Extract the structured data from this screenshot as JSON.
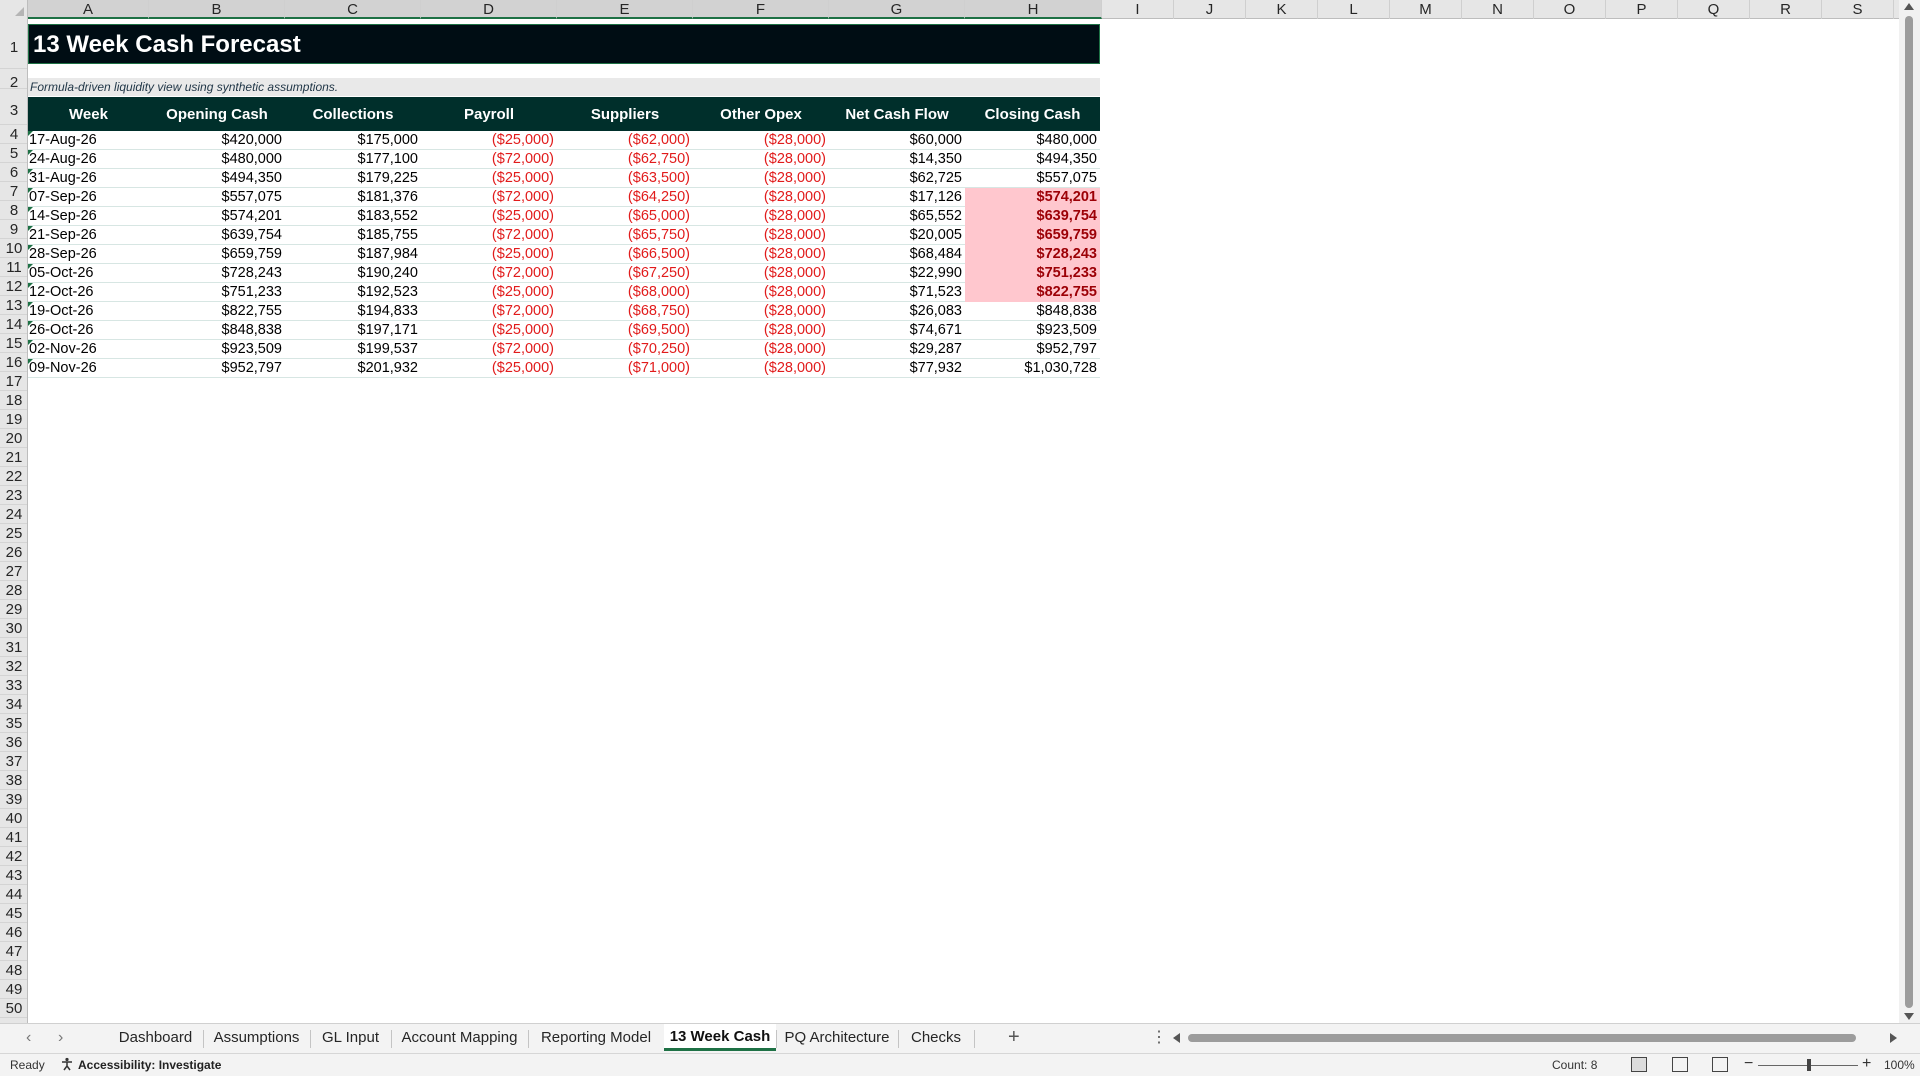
{
  "columns": [
    "A",
    "B",
    "C",
    "D",
    "E",
    "F",
    "G",
    "H",
    "I",
    "J",
    "K",
    "L",
    "M",
    "N",
    "O",
    "P",
    "Q",
    "R",
    "S"
  ],
  "rows_visible": [
    "1",
    "2",
    "3",
    "4",
    "5",
    "6",
    "7",
    "8",
    "9",
    "10",
    "11",
    "12",
    "13",
    "14",
    "15",
    "16",
    "17",
    "18",
    "19",
    "20",
    "21",
    "22",
    "23",
    "24",
    "25",
    "26",
    "27",
    "28",
    "29",
    "30",
    "31",
    "32",
    "33",
    "34",
    "35",
    "36",
    "37",
    "38",
    "39",
    "40",
    "41",
    "42",
    "43",
    "44",
    "45",
    "46",
    "47",
    "48",
    "49",
    "50"
  ],
  "sheet": {
    "title": "13 Week Cash Forecast",
    "subtitle": "Formula-driven liquidity view using synthetic assumptions.",
    "headers": [
      "Week",
      "Opening Cash",
      "Collections",
      "Payroll",
      "Suppliers",
      "Other Opex",
      "Net Cash Flow",
      "Closing Cash"
    ],
    "rows": [
      {
        "week": "17-Aug-26",
        "opening": "$420,000",
        "collections": "$175,000",
        "payroll": "($25,000)",
        "suppliers": "($62,000)",
        "other": "($28,000)",
        "net": "$60,000",
        "closing": "$480,000",
        "highlight": false
      },
      {
        "week": "24-Aug-26",
        "opening": "$480,000",
        "collections": "$177,100",
        "payroll": "($72,000)",
        "suppliers": "($62,750)",
        "other": "($28,000)",
        "net": "$14,350",
        "closing": "$494,350",
        "highlight": false
      },
      {
        "week": "31-Aug-26",
        "opening": "$494,350",
        "collections": "$179,225",
        "payroll": "($25,000)",
        "suppliers": "($63,500)",
        "other": "($28,000)",
        "net": "$62,725",
        "closing": "$557,075",
        "highlight": false
      },
      {
        "week": "07-Sep-26",
        "opening": "$557,075",
        "collections": "$181,376",
        "payroll": "($72,000)",
        "suppliers": "($64,250)",
        "other": "($28,000)",
        "net": "$17,126",
        "closing": "$574,201",
        "highlight": true
      },
      {
        "week": "14-Sep-26",
        "opening": "$574,201",
        "collections": "$183,552",
        "payroll": "($25,000)",
        "suppliers": "($65,000)",
        "other": "($28,000)",
        "net": "$65,552",
        "closing": "$639,754",
        "highlight": true
      },
      {
        "week": "21-Sep-26",
        "opening": "$639,754",
        "collections": "$185,755",
        "payroll": "($72,000)",
        "suppliers": "($65,750)",
        "other": "($28,000)",
        "net": "$20,005",
        "closing": "$659,759",
        "highlight": true
      },
      {
        "week": "28-Sep-26",
        "opening": "$659,759",
        "collections": "$187,984",
        "payroll": "($25,000)",
        "suppliers": "($66,500)",
        "other": "($28,000)",
        "net": "$68,484",
        "closing": "$728,243",
        "highlight": true
      },
      {
        "week": "05-Oct-26",
        "opening": "$728,243",
        "collections": "$190,240",
        "payroll": "($72,000)",
        "suppliers": "($67,250)",
        "other": "($28,000)",
        "net": "$22,990",
        "closing": "$751,233",
        "highlight": true
      },
      {
        "week": "12-Oct-26",
        "opening": "$751,233",
        "collections": "$192,523",
        "payroll": "($25,000)",
        "suppliers": "($68,000)",
        "other": "($28,000)",
        "net": "$71,523",
        "closing": "$822,755",
        "highlight": true
      },
      {
        "week": "19-Oct-26",
        "opening": "$822,755",
        "collections": "$194,833",
        "payroll": "($72,000)",
        "suppliers": "($68,750)",
        "other": "($28,000)",
        "net": "$26,083",
        "closing": "$848,838",
        "highlight": false
      },
      {
        "week": "26-Oct-26",
        "opening": "$848,838",
        "collections": "$197,171",
        "payroll": "($25,000)",
        "suppliers": "($69,500)",
        "other": "($28,000)",
        "net": "$74,671",
        "closing": "$923,509",
        "highlight": false
      },
      {
        "week": "02-Nov-26",
        "opening": "$923,509",
        "collections": "$199,537",
        "payroll": "($72,000)",
        "suppliers": "($70,250)",
        "other": "($28,000)",
        "net": "$29,287",
        "closing": "$952,797",
        "highlight": false
      },
      {
        "week": "09-Nov-26",
        "opening": "$952,797",
        "collections": "$201,932",
        "payroll": "($25,000)",
        "suppliers": "($71,000)",
        "other": "($28,000)",
        "net": "$77,932",
        "closing": "$1,030,728",
        "highlight": false
      }
    ]
  },
  "tabs": {
    "items": [
      "Dashboard",
      "Assumptions",
      "GL Input",
      "Account Mapping",
      "Reporting Model",
      "13 Week Cash",
      "PQ Architecture",
      "Checks"
    ],
    "active": "13 Week Cash",
    "add_label": "+"
  },
  "status": {
    "ready": "Ready",
    "accessibility": "Accessibility: Investigate",
    "count": "Count: 8",
    "zoom": "100%"
  },
  "colors": {
    "title_bg": "#000d14",
    "header_bg": "#002f2b",
    "negative": "#e11b1b",
    "highlight_fill": "#ffc7ce",
    "highlight_text": "#9c0006",
    "accent": "#1e7145"
  }
}
